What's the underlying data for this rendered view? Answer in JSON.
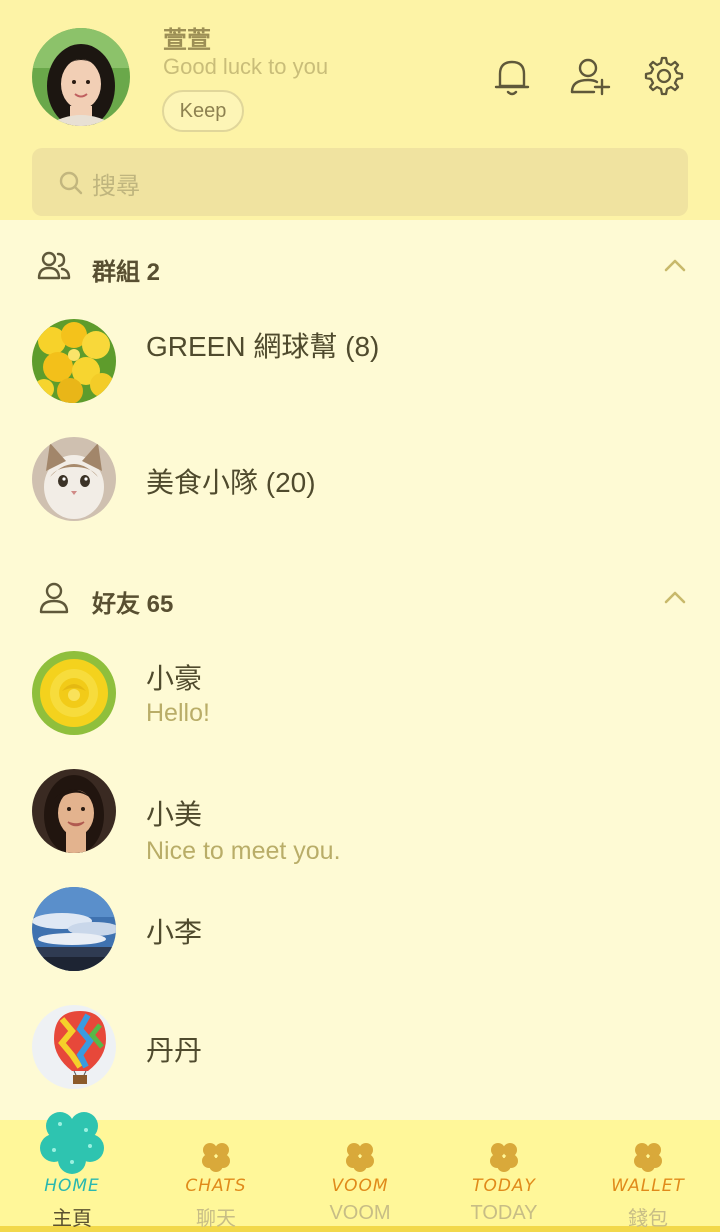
{
  "header": {
    "name": "萱萱",
    "status": "Good luck to you",
    "keep_label": "Keep",
    "icons": [
      "bell-icon",
      "add-friend-icon",
      "gear-icon"
    ]
  },
  "search": {
    "placeholder": "搜尋"
  },
  "groups": {
    "title": "群組 2",
    "items": [
      {
        "name": "GREEN 網球幫 (8)",
        "avatar": "yellow-flowers"
      },
      {
        "name": "美食小隊 (20)",
        "avatar": "cat"
      }
    ]
  },
  "friends": {
    "title": "好友 65",
    "items": [
      {
        "name": "小豪",
        "status": "Hello!",
        "avatar": "yellow-rose"
      },
      {
        "name": "小美",
        "status": "Nice to meet you.",
        "avatar": "woman-portrait"
      },
      {
        "name": "小李",
        "status": "",
        "avatar": "sky-clouds"
      },
      {
        "name": "丹丹",
        "status": "",
        "avatar": "hot-air-balloon"
      }
    ]
  },
  "tabs": [
    {
      "deco": "HOME",
      "label": "主頁",
      "active": true,
      "deco_color": "#2ab8b0"
    },
    {
      "deco": "CHATS",
      "label": "聊天",
      "active": false,
      "deco_color": "#e08a1a"
    },
    {
      "deco": "VOOM",
      "label": "VOOM",
      "active": false,
      "deco_color": "#e08a1a"
    },
    {
      "deco": "TODAY",
      "label": "TODAY",
      "active": false,
      "deco_color": "#e08a1a"
    },
    {
      "deco": "WALLET",
      "label": "錢包",
      "active": false,
      "deco_color": "#e08a1a"
    }
  ],
  "colors": {
    "header_bg": "#fdf3a6",
    "body_bg": "#fefad4",
    "tabbar_bg": "#fff799",
    "status_text": "#b9ad68"
  }
}
